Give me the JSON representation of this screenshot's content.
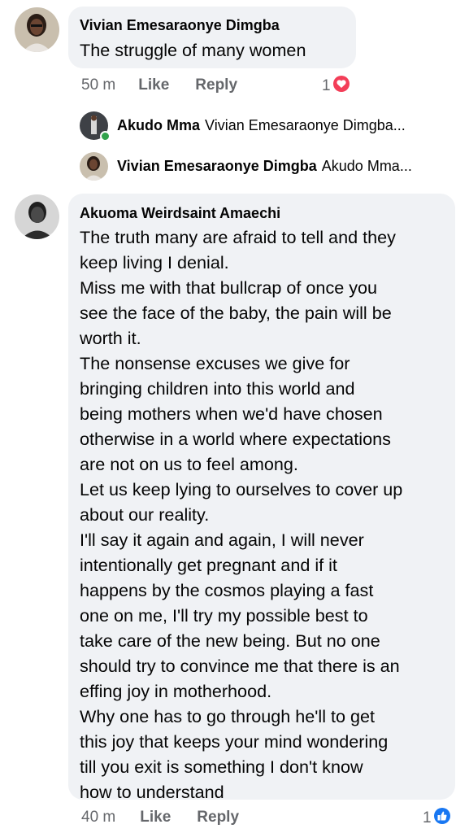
{
  "comment1": {
    "author": "Vivian Emesaraonye Dimgba",
    "text": "The struggle of many women",
    "time": "50 m",
    "like_label": "Like",
    "reply_label": "Reply",
    "reaction_count": "1",
    "reaction_icon": "love-reaction-icon",
    "reaction_color": "#f33e58"
  },
  "replies": [
    {
      "author": "Akudo Mma",
      "preview": "Vivian Emesaraonye Dimgba..."
    },
    {
      "author": "Vivian Emesaraonye Dimgba",
      "preview": "Akudo Mma..."
    }
  ],
  "comment2": {
    "author": "Akuoma Weirdsaint Amaechi",
    "text": "The truth many are afraid to tell and they\nkeep living I denial.\nMiss me with that bullcrap of once you\nsee the face of the baby, the pain will be\nworth it.\nThe nonsense excuses we give for\nbringing children into this world and\nbeing mothers when we'd have chosen\notherwise in a world where expectations\nare not on us to feel among.\nLet us keep lying to ourselves to cover up\nabout our reality.\nI'll say it again and again, I will never\nintentionally get pregnant and if it\nhappens by the cosmos playing a fast\none on me, I'll try my possible best to\ntake care of the new being. But no one\nshould try to convince me that there is an\neffing joy in motherhood.\nWhy one has to go through he'll to get\nthis joy that keeps your mind wondering\ntill you exit is something I don't know\nhow to understand",
    "time": "40 m",
    "like_label": "Like",
    "reply_label": "Reply",
    "reaction_count": "1",
    "reaction_icon": "like-reaction-icon",
    "reaction_color": "#1877f2"
  }
}
